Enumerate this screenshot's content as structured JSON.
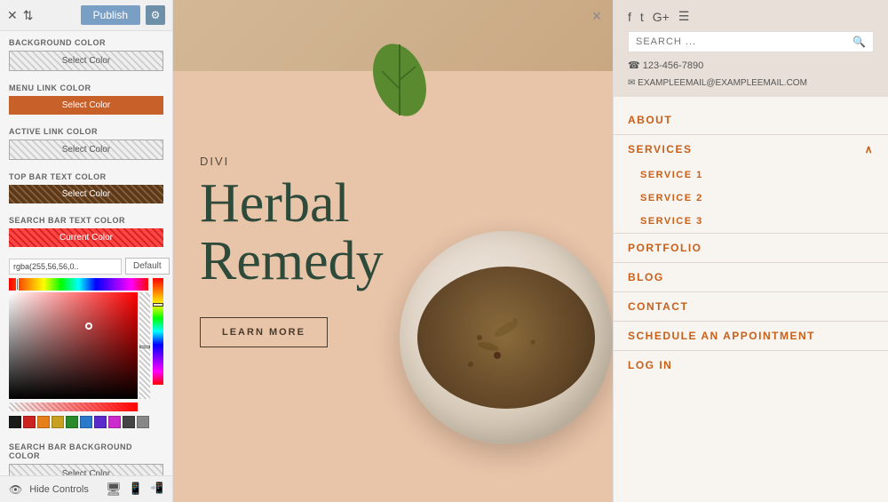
{
  "topbar": {
    "publish_label": "Publish",
    "gear_icon": "⚙",
    "close_icon": "✕",
    "x_icon": "×"
  },
  "left_panel": {
    "sections": [
      {
        "label": "BACKGROUND COLOR",
        "btn_label": "Select Color",
        "btn_type": "gray"
      },
      {
        "label": "MENU LINK COLOR",
        "btn_label": "Select Color",
        "btn_type": "orange"
      },
      {
        "label": "ACTIVE LINK COLOR",
        "btn_label": "Select Color",
        "btn_type": "gray"
      },
      {
        "label": "TOP BAR TEXT COLOR",
        "btn_label": "Select Color",
        "btn_type": "brown"
      },
      {
        "label": "SEARCH BAR TEXT COLOR",
        "btn_label": "Current Color",
        "btn_type": "red"
      }
    ],
    "color_value": "rgba(255,56,56,0..",
    "default_label": "Default",
    "search_bar_bg_label": "SEARCH BAR BACKGROUND COLOR",
    "search_bar_bg_btn": "Select Color"
  },
  "bottom_bar": {
    "hide_label": "Hide Controls",
    "eye_icon": "👁"
  },
  "center": {
    "divi_label": "DIVI",
    "hero_title": "Herbal\nRemedy",
    "learn_more": "LEARN MORE"
  },
  "right_panel": {
    "social_icons": [
      "f",
      "t",
      "G+",
      "☰"
    ],
    "search_placeholder": "SEARCH ...",
    "phone": "☎ 123-456-7890",
    "email": "✉ EXAMPLEEMAIL@EXAMPLEEMAIL.COM",
    "nav_items": [
      {
        "label": "ABOUT",
        "has_children": false,
        "expanded": false
      },
      {
        "label": "SERVICES",
        "has_children": true,
        "expanded": true
      },
      {
        "label": "SERVICE 1",
        "is_sub": true
      },
      {
        "label": "SERVICE 2",
        "is_sub": true
      },
      {
        "label": "SERVICE 3",
        "is_sub": true
      },
      {
        "label": "PORTFOLIO",
        "has_children": false,
        "expanded": false
      },
      {
        "label": "BLOG",
        "has_children": false,
        "expanded": false
      },
      {
        "label": "CONTACT",
        "has_children": false,
        "expanded": false
      },
      {
        "label": "SCHEDULE AN APPOINTMENT",
        "has_children": false,
        "expanded": false
      },
      {
        "label": "LOG IN",
        "has_children": false,
        "expanded": false
      }
    ]
  }
}
